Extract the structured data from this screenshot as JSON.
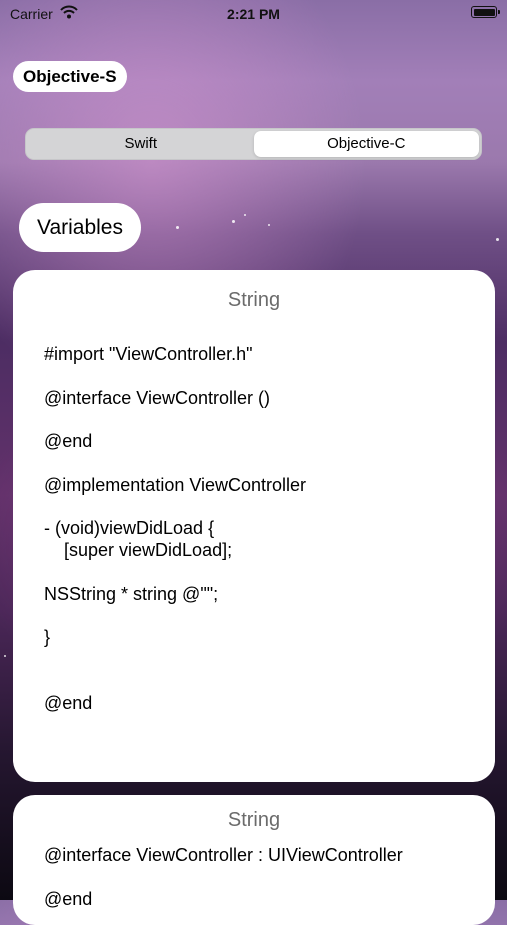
{
  "status_bar": {
    "carrier": "Carrier",
    "time": "2:21 PM"
  },
  "app_title": "Objective-S",
  "segmented_control": {
    "options": [
      "Swift",
      "Objective-C"
    ],
    "selected": "Objective-C"
  },
  "section_title": "Variables",
  "cards": [
    {
      "title": "String",
      "code": "#import \"ViewController.h\"\n\n@interface ViewController ()\n\n@end\n\n@implementation ViewController\n\n- (void)viewDidLoad {\n    [super viewDidLoad];\n\nNSString * string @\"\";\n\n}\n\n\n@end"
    },
    {
      "title": "String",
      "code": "@interface ViewController : UIViewController\n\n@end"
    }
  ],
  "colors": {
    "card_background": "#ffffff",
    "card_title": "#6b6b6b",
    "segment_track": "#d4d4d6"
  }
}
